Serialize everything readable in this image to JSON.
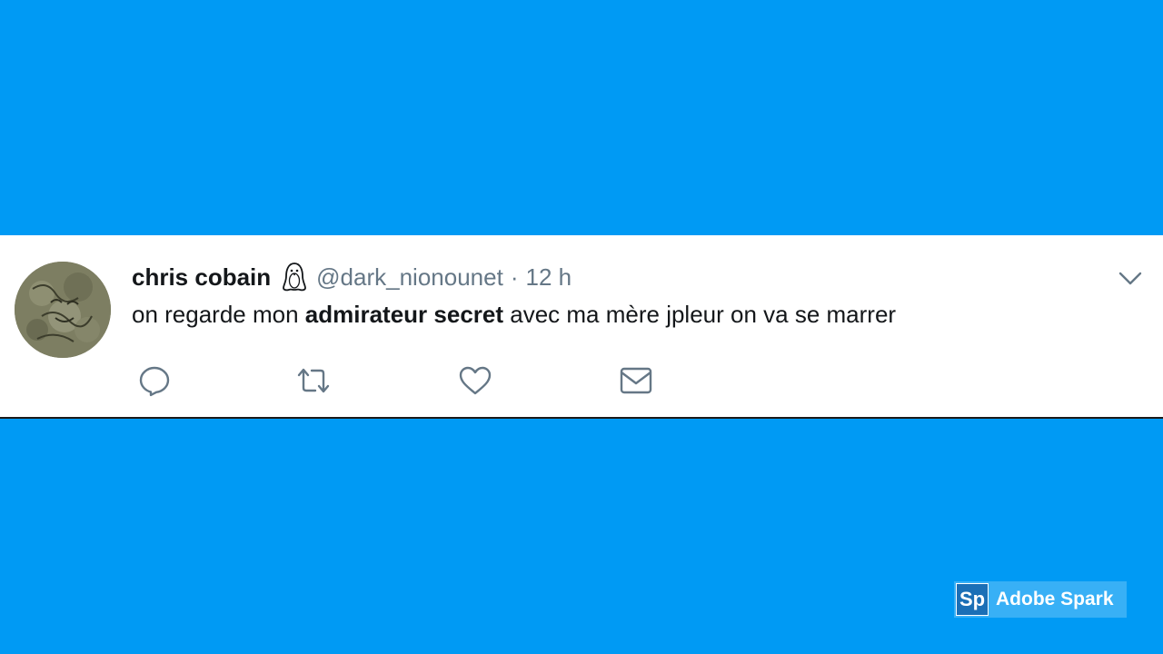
{
  "tweet": {
    "display_name": "chris cobain",
    "handle": "@dark_nionounet",
    "separator": "·",
    "time": "12 h",
    "text_before": "on regarde mon ",
    "text_bold": "admirateur secret",
    "text_after": " avec ma mère jpleur on va se marrer",
    "emoji": "penguin-icon"
  },
  "actions": [
    "reply-icon",
    "retweet-icon",
    "like-icon",
    "direct-message-icon"
  ],
  "watermark": {
    "logo": "Sp",
    "label": "Adobe Spark"
  },
  "colors": {
    "background": "#009af4",
    "card": "#ffffff",
    "text": "#14171a",
    "secondary": "#657786"
  }
}
